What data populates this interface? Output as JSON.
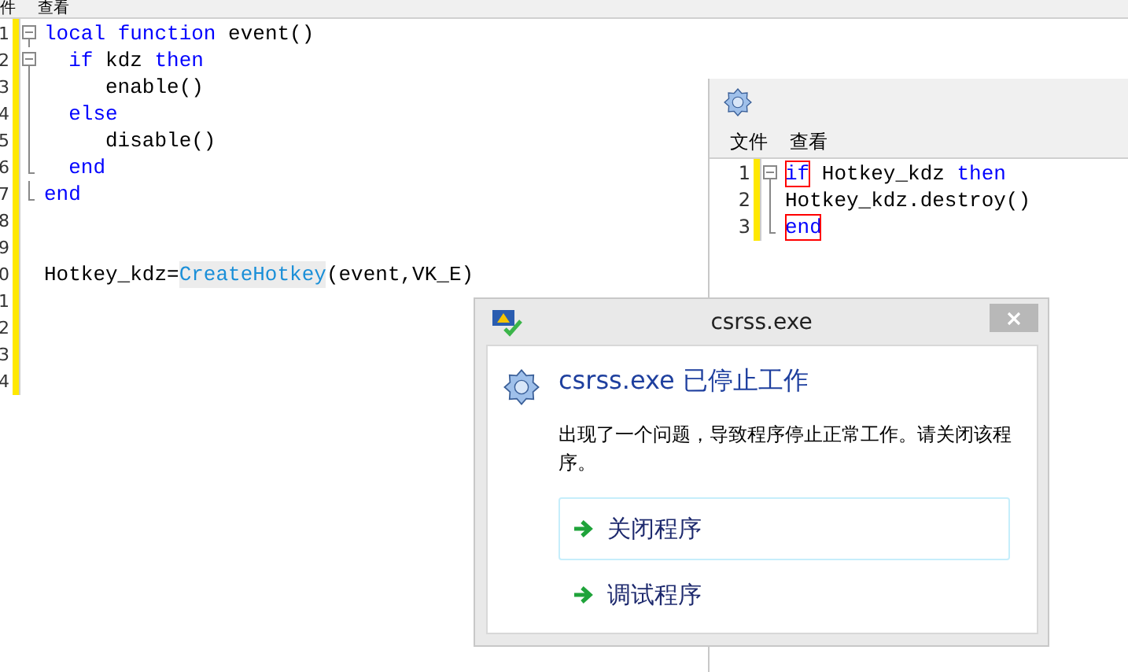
{
  "main_editor": {
    "menu": [
      "件",
      "查看"
    ],
    "lines": [
      {
        "number": "1",
        "kind": "fold_start",
        "tokens": [
          {
            "kind": "keyword",
            "text": "local"
          },
          {
            "kind": "keyword",
            "text": " function"
          },
          {
            "kind": "plain",
            "text": " event()"
          }
        ]
      },
      {
        "number": "2",
        "kind": "fold_start",
        "tokens": [
          {
            "kind": "keyword",
            "text": "  if"
          },
          {
            "kind": "plain",
            "text": " kdz "
          },
          {
            "kind": "keyword",
            "text": "then"
          }
        ]
      },
      {
        "number": "3",
        "kind": "fold_body",
        "tokens": [
          {
            "kind": "plain",
            "text": "     enable()"
          }
        ]
      },
      {
        "number": "4",
        "kind": "fold_body",
        "tokens": [
          {
            "kind": "keyword",
            "text": "  else"
          }
        ]
      },
      {
        "number": "5",
        "kind": "fold_body",
        "tokens": [
          {
            "kind": "plain",
            "text": "     disable()"
          }
        ]
      },
      {
        "number": "6",
        "kind": "fold_end",
        "tokens": [
          {
            "kind": "keyword",
            "text": "  end"
          }
        ]
      },
      {
        "number": "7",
        "kind": "fold_end",
        "tokens": [
          {
            "kind": "keyword",
            "text": "end"
          }
        ]
      },
      {
        "number": "8",
        "kind": "plain"
      },
      {
        "number": "9",
        "kind": "plain"
      },
      {
        "number": "0",
        "kind": "plain",
        "tokens": [
          {
            "kind": "plain",
            "text": "Hotkey_kdz="
          },
          {
            "kind": "function",
            "text": "CreateHotkey"
          },
          {
            "kind": "plain",
            "text": "(event,VK_E)"
          }
        ]
      },
      {
        "number": "1",
        "kind": "plain"
      },
      {
        "number": "2",
        "kind": "plain"
      },
      {
        "number": "3",
        "kind": "plain"
      },
      {
        "number": "4",
        "kind": "plain"
      }
    ]
  },
  "second_editor": {
    "menu": [
      "文件",
      "查看"
    ],
    "lines": [
      {
        "number": "1",
        "kind": "fold_start",
        "tokens": [
          {
            "kind": "brace",
            "text": "if"
          },
          {
            "kind": "plain",
            "text": " Hotkey_kdz "
          },
          {
            "kind": "keyword",
            "text": "then"
          }
        ]
      },
      {
        "number": "2",
        "kind": "fold_body",
        "tokens": [
          {
            "kind": "plain",
            "text": "Hotkey_kdz.destroy()"
          }
        ]
      },
      {
        "number": "3",
        "kind": "fold_end",
        "tokens": [
          {
            "kind": "brace",
            "text": "end"
          }
        ]
      }
    ]
  },
  "dialog": {
    "title": "csrss.exe",
    "heading": "csrss.exe 已停止工作",
    "message": "出现了一个问题，导致程序停止正常工作。请关闭该程序。",
    "options": [
      {
        "label": "关闭程序",
        "selected": true
      },
      {
        "label": "调试程序",
        "selected": false
      }
    ]
  }
}
